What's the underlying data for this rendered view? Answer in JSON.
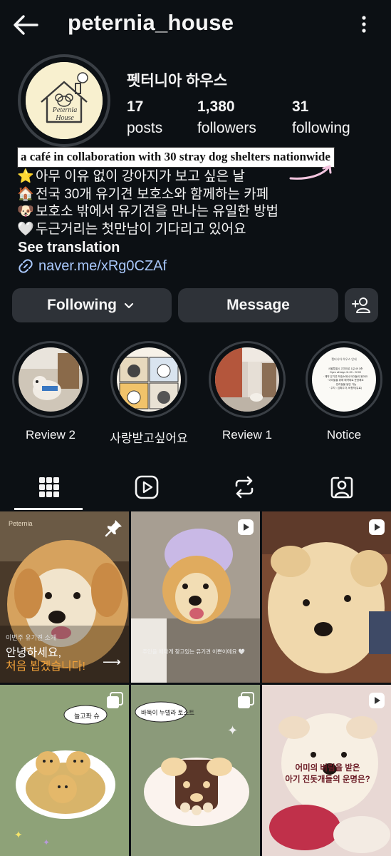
{
  "header": {
    "username": "peternia_house",
    "back_icon": "back-arrow-icon",
    "more_icon": "more-vertical-icon"
  },
  "profile": {
    "avatar_text_line1": "Peternia",
    "avatar_text_line2": "House",
    "display_name": "펫터니아 하우스",
    "stats": [
      {
        "value": "17",
        "label": "posts"
      },
      {
        "value": "1,380",
        "label": "followers"
      },
      {
        "value": "31",
        "label": "following"
      }
    ]
  },
  "annotation": {
    "text": "a café in collaboration with 30 stray dog shelters nationwide"
  },
  "bio": {
    "lines": [
      {
        "emoji": "⭐",
        "text": "아무 이유 없이 강아지가 보고 싶은 날"
      },
      {
        "emoji": "🏠",
        "text": "전국 30개 유기견 보호소와 함께하는 카페"
      },
      {
        "emoji": "🐶",
        "text": "보호소 밖에서 유기견을 만나는 유일한 방법"
      },
      {
        "emoji": "🤍",
        "text": "두근거리는 첫만남이 기다리고 있어요"
      }
    ],
    "see_translation": "See translation",
    "link": "naver.me/xRg0CZAf"
  },
  "actions": {
    "following_label": "Following",
    "message_label": "Message"
  },
  "highlights": [
    {
      "label": "Review 2"
    },
    {
      "label": "사랑받고싶어요"
    },
    {
      "label": "Review 1"
    },
    {
      "label": "Notice"
    }
  ],
  "notice_thumb": {
    "title": "펫터니아 하우스 안내",
    "lines": [
      "서울특별시 고여이로 1길 49 1층",
      "Open all days 11:00 - 22:00",
      "· 예약 유기견 보호소에서 아이들이 왔어요",
      "· 아이들을 위해 예약제로 운영해요",
      "· 반려동물 동반 가능",
      "· 주차 : 임확주차, 비협약(유료)"
    ]
  },
  "tabs": [
    {
      "name": "grid",
      "icon": "grid-icon"
    },
    {
      "name": "reels",
      "icon": "reels-icon"
    },
    {
      "name": "reposts",
      "icon": "repost-icon"
    },
    {
      "name": "tagged",
      "icon": "tagged-person-icon"
    }
  ],
  "posts": [
    {
      "badge": "pin-icon",
      "overlay_small": "이번주 유기견 소개",
      "overlay_line1": "안녕하세요,",
      "overlay_line2": "처음 뵙겠습니다!",
      "corner_text": "Peternia"
    },
    {
      "badge": "reel-icon",
      "overlay_small": "주인을 애타게 찾고있는 유기견 이쁜이에요 🤍"
    },
    {
      "badge": "reel-icon"
    },
    {
      "badge": "carousel-icon",
      "bubble": "늘고퐈 슈"
    },
    {
      "badge": "carousel-icon",
      "bubble": "바둑이 누텔라 토스트"
    },
    {
      "badge": "reel-icon",
      "overlay_line1": "어미의 버림을 받은",
      "overlay_line2": "아기 진돗개들의 운명은?"
    }
  ],
  "colors": {
    "background": "#0c1014",
    "button": "#2e3238",
    "link": "#a8c7fa",
    "orange_text": "#f2a23a"
  }
}
